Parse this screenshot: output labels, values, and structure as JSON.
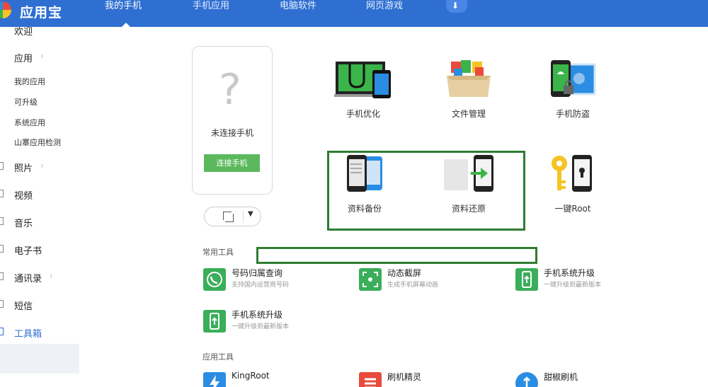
{
  "app": {
    "title": "应用宝"
  },
  "nav": {
    "tabs": [
      "我的手机",
      "手机应用",
      "电脑软件",
      "网页游戏"
    ],
    "active": "我的手机",
    "download_icon": "download-arrow-icon"
  },
  "sidebar": {
    "welcome": "欢迎",
    "apps": "应用",
    "app_sub": [
      "我的应用",
      "可升级",
      "系统应用",
      "山寨应用检测"
    ],
    "items": [
      "照片",
      "视频",
      "音乐",
      "电子书",
      "通讯录",
      "短信",
      "工具箱"
    ],
    "active": "工具箱"
  },
  "phone": {
    "status": "未连接手机",
    "connect_label": "连接手机",
    "question_icon": "?"
  },
  "tools": [
    {
      "label": "手机优化",
      "icon": "stethoscope-phone-icon"
    },
    {
      "label": "文件管理",
      "icon": "file-box-icon"
    },
    {
      "label": "手机防盗",
      "icon": "phone-lock-icon"
    },
    {
      "label": "资料备份",
      "icon": "backup-phone-icon"
    },
    {
      "label": "资料还原",
      "icon": "restore-phone-icon"
    },
    {
      "label": "一键Root",
      "icon": "key-phone-icon"
    }
  ],
  "common_tools": {
    "title": "常用工具",
    "items": [
      {
        "name": "号码归属查询",
        "desc": "支持国内运营商号码"
      },
      {
        "name": "动态截屏",
        "desc": "生成手机屏幕动画"
      },
      {
        "name": "手机系统升级",
        "desc": "一键升级到最新版本"
      },
      {
        "name": "手机系统升级",
        "desc": "一键升级到最新版本"
      }
    ]
  },
  "app_tools": {
    "title": "应用工具",
    "items": [
      {
        "name": "KingRoot"
      },
      {
        "name": "刷机精灵"
      },
      {
        "name": "甜椒刷机"
      }
    ]
  },
  "colors": {
    "topbar": "#2e6fd1",
    "accent_green": "#5cb85c",
    "highlight": "#2e7d32"
  }
}
